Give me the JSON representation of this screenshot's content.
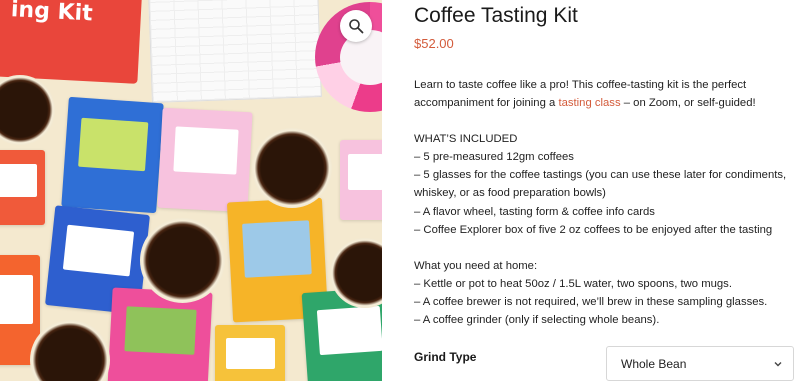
{
  "image": {
    "kit_box_text": "ing Kit",
    "zoom_icon": "magnifier-zoom-icon"
  },
  "product": {
    "title": "Coffee Tasting Kit",
    "price": "$52.00",
    "intro_prefix": "Learn to taste coffee like a pro! This coffee-tasting kit is the perfect accompaniment for joining a ",
    "intro_link": "tasting class",
    "intro_suffix": " – on Zoom, or self-guided!",
    "included_heading": "WHAT’S INCLUDED",
    "included": [
      "– 5 pre-measured 12gm coffees",
      "– 5 glasses for the coffee tastings (you can use these later for condiments, whiskey, or as food preparation bowls)",
      "– A flavor wheel, tasting form & coffee info cards",
      "– Coffee Explorer box of five 2 oz coffees to be enjoyed after the tasting"
    ],
    "need_heading": "What you need at home:",
    "need": [
      "– Kettle or pot to heat 50oz / 1.5L water, two spoons, two mugs.",
      "– A coffee brewer is not required, we’ll brew in these sampling glasses.",
      "– A coffee grinder (only if selecting whole beans)."
    ]
  },
  "options": {
    "grind_label": "Grind Type",
    "grind_selected": "Whole Bean"
  },
  "colors": {
    "accent": "#d35b3b"
  }
}
